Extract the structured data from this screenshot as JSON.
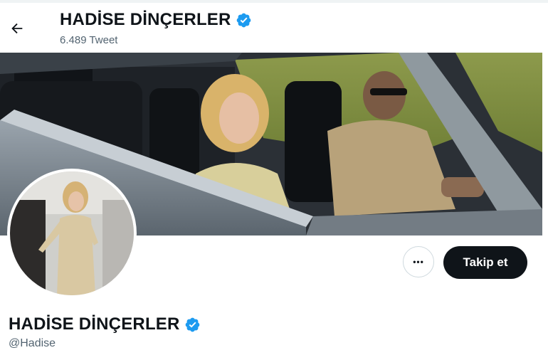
{
  "header": {
    "title": "HADİSE DİNÇERLER",
    "tweet_count": "6.489 Tweet"
  },
  "profile": {
    "display_name": "HADİSE DİNÇERLER",
    "handle": "@Hadise",
    "verified": true
  },
  "actions": {
    "more_label": "•••",
    "follow_label": "Takip et"
  },
  "icons": {
    "back": "back-arrow-icon",
    "verified": "verified-badge-icon",
    "more": "more-options-icon"
  },
  "colors": {
    "verified_blue": "#1d9bf0",
    "button_dark": "#0f1419",
    "secondary_text": "#536471"
  }
}
